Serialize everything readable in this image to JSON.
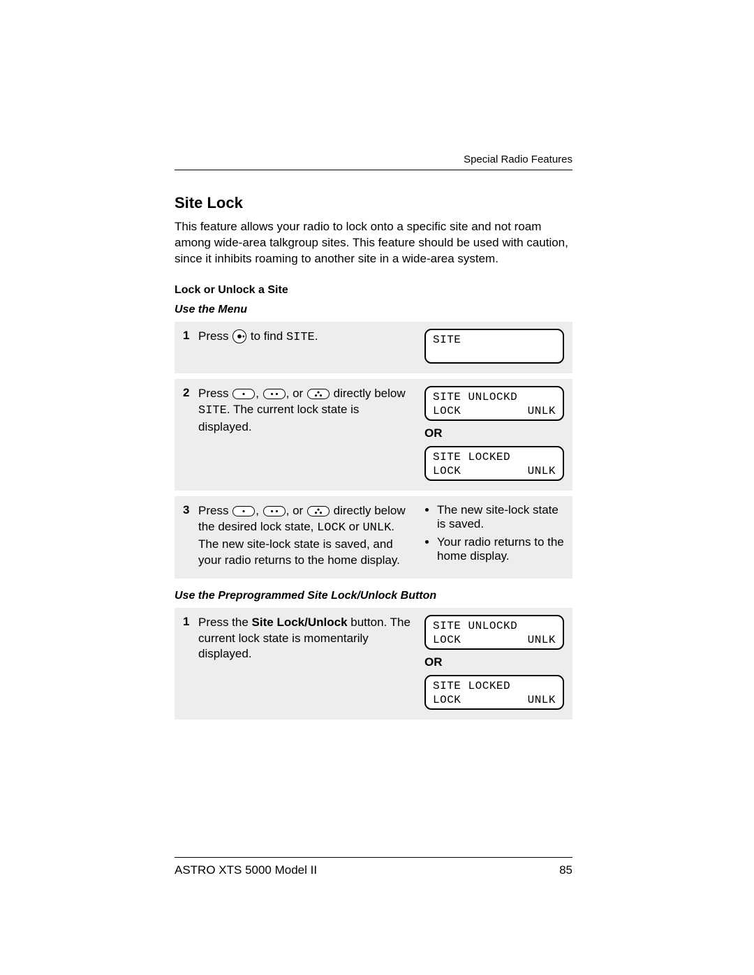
{
  "runningHead": "Special Radio Features",
  "title": "Site Lock",
  "intro": "This feature allows your radio to lock onto a specific site and not roam among wide-area talkgroup sites. This feature should be used with caution, since it inhibits roaming to another site in a wide-area system.",
  "sub1": "Lock or Unlock a Site",
  "subMenu": "Use the Menu",
  "step1": {
    "num": "1",
    "press": "Press ",
    "afterBtn": " to find ",
    "code": "SITE",
    "tail": ".",
    "lcd_line1": "SITE"
  },
  "step2": {
    "num": "2",
    "press": "Press ",
    "comma1": ", ",
    "comma2": ", or ",
    "afterBtns1": " directly below ",
    "code": "SITE",
    "afterBtns2": ". The current lock state is displayed.",
    "lcdA_line1": "SITE UNLOCKD",
    "lcdA_lock": "LOCK",
    "lcdA_unlk": "UNLK",
    "or": "OR",
    "lcdB_line1": "SITE LOCKED",
    "lcdB_lock": "LOCK",
    "lcdB_unlk": "UNLK"
  },
  "step3": {
    "num": "3",
    "press": "Press ",
    "comma1": ", ",
    "comma2": ", or ",
    "afterBtns1": " directly below the desired lock state, ",
    "code1": "LOCK",
    "mid": " or ",
    "code2": "UNLK",
    "afterBtns2": ". The new site-lock state is saved, and your radio returns to the home display.",
    "bullet1": "The new site-lock state is saved.",
    "bullet2": "Your radio returns to the home display."
  },
  "subButton": "Use the Preprogrammed Site Lock/Unlock Button",
  "stepB1": {
    "num": "1",
    "pre": "Press the ",
    "bold": "Site Lock/Unlock",
    "post": " button. The current lock state is momentarily displayed.",
    "lcdA_line1": "SITE UNLOCKD",
    "lcdA_lock": "LOCK",
    "lcdA_unlk": "UNLK",
    "or": "OR",
    "lcdB_line1": "SITE LOCKED",
    "lcdB_lock": "LOCK",
    "lcdB_unlk": "UNLK"
  },
  "footerModel": "ASTRO XTS 5000 Model II",
  "footerPage": "85"
}
